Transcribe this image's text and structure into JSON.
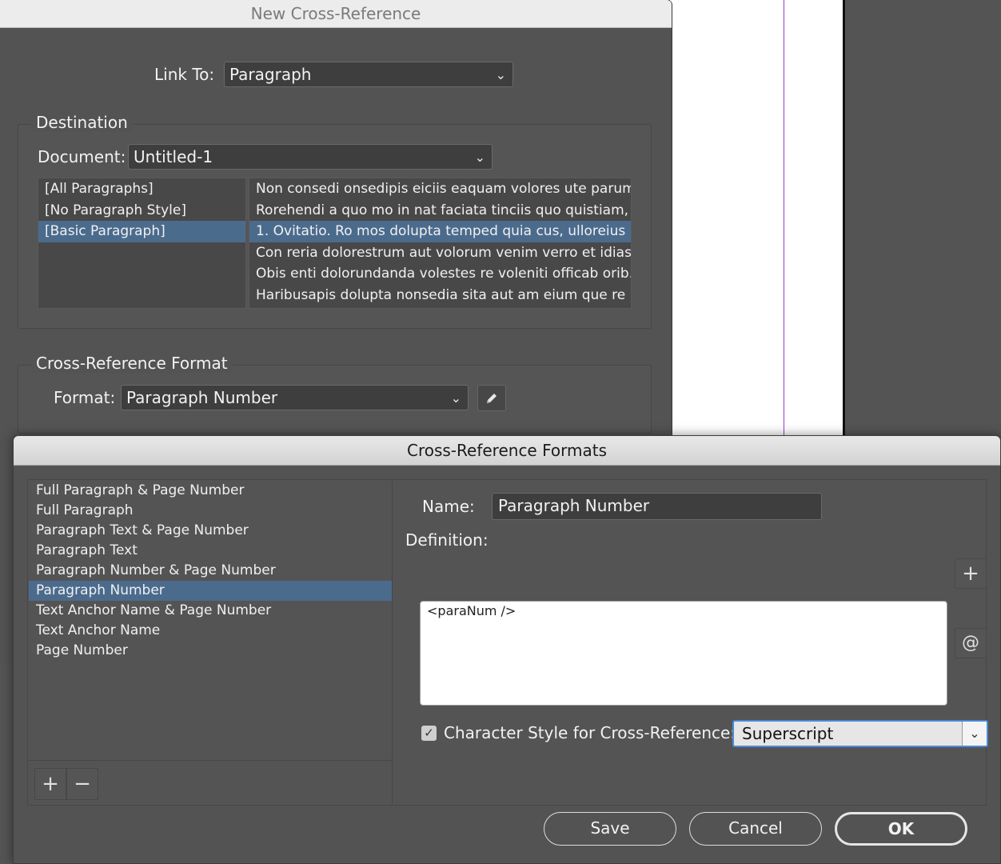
{
  "cross_reference_dialog": {
    "title": "New Cross-Reference",
    "link_to": {
      "label": "Link To:",
      "value": "Paragraph"
    },
    "destination": {
      "group_title": "Destination",
      "document_label": "Document:",
      "document_value": "Untitled-1",
      "paragraph_styles": [
        "[All Paragraphs]",
        "[No Paragraph Style]",
        "[Basic Paragraph]"
      ],
      "selected_style": "[Basic Paragraph]",
      "paragraphs": [
        "Non consedi onsedipis eiciis eaquam volores ute parum...",
        "Rorehendi a quo mo in nat faciata tinciis quo quistiam, ...",
        "1. Ovitatio. Ro mos dolupta temped quia cus, ulloreius ...",
        "Con reria dolorestrum aut volorum venim verro et idias ...",
        "Obis enti dolorundanda volestes re voleniti officab orib...",
        "Haribusapis dolupta nonsedia sita aut am eium que re ..."
      ],
      "selected_paragraph": "1. Ovitatio. Ro mos dolupta temped quia cus, ulloreius ..."
    },
    "format_group": {
      "group_title": "Cross-Reference Format",
      "format_label": "Format:",
      "format_value": "Paragraph Number"
    }
  },
  "formats_dialog": {
    "title": "Cross-Reference Formats",
    "formats": [
      "Full Paragraph & Page Number",
      "Full Paragraph",
      "Paragraph Text & Page Number",
      "Paragraph Text",
      "Paragraph Number & Page Number",
      "Paragraph Number",
      "Text Anchor Name & Page Number",
      "Text Anchor Name",
      "Page Number"
    ],
    "selected_format": "Paragraph Number",
    "name_label": "Name:",
    "name_value": "Paragraph Number",
    "definition_label": "Definition:",
    "definition_value": "<paraNum />",
    "char_style_checked": true,
    "char_style_label": "Character Style for Cross-Reference:",
    "char_style_value": "Superscript",
    "buttons": {
      "save": "Save",
      "cancel": "Cancel",
      "ok": "OK"
    },
    "icons": {
      "add_format": "+",
      "remove_format": "−",
      "insert_building_block": "+",
      "insert_special_char": "@"
    }
  },
  "colors": {
    "selection": "#4b6b8d",
    "focus_ring": "#4a8ad6",
    "guide": "#9b3bd6"
  }
}
